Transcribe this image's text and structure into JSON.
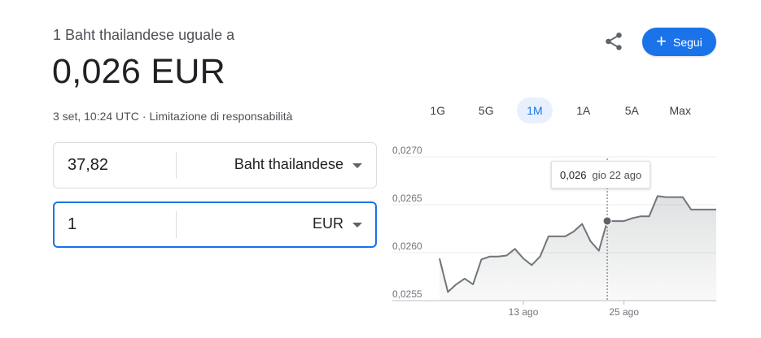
{
  "header": {
    "subtitle": "1 Baht thailandese uguale a",
    "rate": "0,026 EUR",
    "timestamp": "3 set, 10:24 UTC",
    "separator": "·",
    "disclaimer": "Limitazione di responsabilità"
  },
  "actions": {
    "share_icon": "share-icon",
    "follow_label": "Segui",
    "follow_icon": "plus-icon",
    "accent": "#1a73e8"
  },
  "converter": {
    "from": {
      "value": "37,82",
      "currency": "Baht thailandese"
    },
    "to": {
      "value": "1",
      "currency": "EUR"
    }
  },
  "tabs": [
    {
      "label": "1G",
      "selected": false
    },
    {
      "label": "5G",
      "selected": false
    },
    {
      "label": "1M",
      "selected": true
    },
    {
      "label": "1A",
      "selected": false
    },
    {
      "label": "5A",
      "selected": false
    },
    {
      "label": "Max",
      "selected": false
    }
  ],
  "tooltip": {
    "value": "0,026",
    "date": "gio 22 ago"
  },
  "chart_data": {
    "type": "line",
    "ylim": [
      0.0255,
      0.027
    ],
    "y_ticks": [
      0.027,
      0.0265,
      0.026,
      0.0255
    ],
    "y_tick_labels": [
      "0,0270",
      "0,0265",
      "0,0260",
      "0,0255"
    ],
    "x_tick_labels": [
      "13 ago",
      "25 ago"
    ],
    "x_tick_positions": [
      13,
      25
    ],
    "x_range": [
      3,
      36
    ],
    "grid": true,
    "line_color": "#70757a",
    "highlight_x": 23,
    "x": [
      3,
      4,
      5,
      6,
      7,
      8,
      9,
      10,
      11,
      12,
      13,
      14,
      15,
      16,
      17,
      18,
      19,
      20,
      21,
      22,
      23,
      24,
      25,
      26,
      27,
      28,
      29,
      30,
      31,
      32,
      33,
      34,
      35,
      36
    ],
    "values": [
      0.02594,
      0.02559,
      0.02567,
      0.02573,
      0.02567,
      0.02593,
      0.02596,
      0.02596,
      0.02597,
      0.02604,
      0.02594,
      0.02587,
      0.02596,
      0.02617,
      0.02617,
      0.02617,
      0.02622,
      0.0263,
      0.02612,
      0.02602,
      0.02633,
      0.02633,
      0.02633,
      0.02636,
      0.02638,
      0.02638,
      0.02659,
      0.02658,
      0.02658,
      0.02658,
      0.02645,
      0.02645,
      0.02645,
      0.02645
    ]
  }
}
